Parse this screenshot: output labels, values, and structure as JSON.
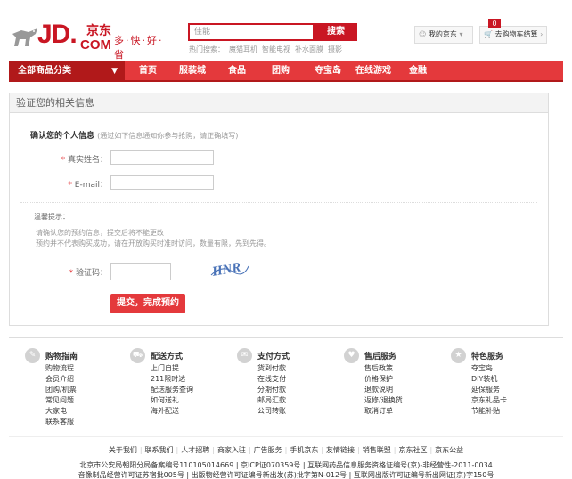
{
  "header": {
    "logo_jd": "JD.",
    "logo_cn": "京东",
    "logo_com": "COM",
    "slogan": "多·快·好·省",
    "search_placeholder": "佳能",
    "search_button": "搜索",
    "hot_label": "热门搜索：",
    "hot_words": [
      "魔猫耳机",
      "智能电视",
      "补水面膜",
      "摄影"
    ],
    "my_jd": "我的京东",
    "cart_label": "去购物车结算",
    "cart_count": "0"
  },
  "nav": {
    "all_categories": "全部商品分类",
    "items": [
      "首页",
      "服装城",
      "食品",
      "团购",
      "夺宝岛",
      "在线游戏",
      "金融"
    ]
  },
  "main": {
    "panel_title": "验证您的相关信息",
    "section_title": "确认您的个人信息",
    "section_note": "(通过如下信息通知你参与抢购，请正确填写)",
    "name_label": "真实姓名：",
    "email_label": "E-mail：",
    "tip_title": "温馨提示：",
    "tip_lines": [
      "请确认您的预约信息，提交后将不能更改",
      "预约并不代表购买成功，请在开放购买时准时访问，数量有限，先到先得。"
    ],
    "captcha_label": "验证码：",
    "captcha_text": "HNR",
    "submit_button": "提交，完成预约"
  },
  "help": [
    {
      "title": "购物指南",
      "icon": "shopping-guide-icon",
      "glyph": "✎",
      "links": [
        "购物流程",
        "会员介绍",
        "团购/机票",
        "常见问题",
        "大家电",
        "联系客服"
      ]
    },
    {
      "title": "配送方式",
      "icon": "delivery-icon",
      "glyph": "⛟",
      "links": [
        "上门自提",
        "211限时达",
        "配送服务查询",
        "如何送礼",
        "海外配送"
      ]
    },
    {
      "title": "支付方式",
      "icon": "payment-icon",
      "glyph": "✉",
      "links": [
        "货到付款",
        "在线支付",
        "分期付款",
        "邮局汇款",
        "公司转账"
      ]
    },
    {
      "title": "售后服务",
      "icon": "after-sales-icon",
      "glyph": "♥",
      "links": [
        "售后政策",
        "价格保护",
        "退款说明",
        "返修/退换货",
        "取消订单"
      ]
    },
    {
      "title": "特色服务",
      "icon": "special-service-icon",
      "glyph": "★",
      "links": [
        "夺宝岛",
        "DIY装机",
        "延保服务",
        "京东礼品卡",
        "节能补贴"
      ]
    }
  ],
  "footer": {
    "links": [
      "关于我们",
      "联系我们",
      "人才招聘",
      "商家入驻",
      "广告服务",
      "手机京东",
      "友情链接",
      "销售联盟",
      "京东社区",
      "京东公益"
    ],
    "line1": "北京市公安局朝阳分局备案编号110105014669 | 京ICP证070359号 | 互联网药品信息服务资格证编号(京)-非经营性-2011-0034",
    "line2": "音像制品经营许可证苏宿批005号 | 出版物经营许可证编号新出发(苏)批字第N-012号 | 互联网出版许可证编号新出网证(京)字150号"
  },
  "colors": {
    "brand_red": "#c91623",
    "nav_red": "#e4393c",
    "nav_dark": "#b1191a"
  }
}
